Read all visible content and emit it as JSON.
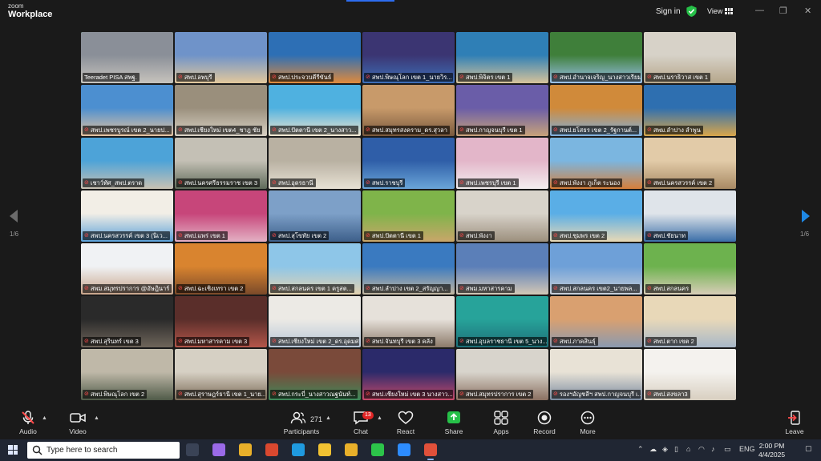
{
  "app": {
    "brand_top": "zoom",
    "brand_name": "Workplace",
    "signin_label": "Sign in",
    "view_label": "View"
  },
  "window_controls": [
    "—",
    "❐",
    "✕"
  ],
  "pagination": {
    "left_count": "1/6",
    "right_count": "1/6"
  },
  "participants": [
    {
      "name": "Teeradet PISA สพฐ.",
      "muted": false,
      "active": true,
      "c1": "#8a8f98",
      "c2": "#c7c3bd"
    },
    {
      "name": "สพป.ลพบุรี",
      "muted": true,
      "c1": "#6f93c9",
      "c2": "#e3c89c"
    },
    {
      "name": "สพป.ประจวบคีรีขันธ์",
      "muted": true,
      "c1": "#2d6fb5",
      "c2": "#e08a3c"
    },
    {
      "name": "สพป.พิษณุโลก เขต 1_นายวิร...",
      "muted": true,
      "c1": "#3b3572",
      "c2": "#3e6fb8"
    },
    {
      "name": "สพป.พิจิตร เขต 1",
      "muted": true,
      "c1": "#2f7fb6",
      "c2": "#d6c39a"
    },
    {
      "name": "สพป.อำนาจเจริญ_นางสาวเรียมระ",
      "muted": true,
      "c1": "#3f7f3a",
      "c2": "#9bc1ea"
    },
    {
      "name": "สพป.นราธิวาส เขต 1",
      "muted": true,
      "c1": "#d7d2c8",
      "c2": "#b5a68a"
    },
    {
      "name": "สพป.เพชรบูรณ์ เขต 2_นายป...",
      "muted": true,
      "c1": "#4c8fd0",
      "c2": "#e6c3a0"
    },
    {
      "name": "สพป.เชียงใหม่ เขต4_ชาฎ ชัย",
      "muted": true,
      "c1": "#9a8f7c",
      "c2": "#d8d1c4"
    },
    {
      "name": "สพป.ปัตตานี เขต 2_นางสาว...",
      "muted": true,
      "c1": "#4fb1e0",
      "c2": "#f1e6d0"
    },
    {
      "name": "สพป.สมุทรสงคราม_ดร.สุวลา",
      "muted": true,
      "c1": "#c89a6a",
      "c2": "#7a5a3e"
    },
    {
      "name": "สพป.กาญจนบุรี เขต 1",
      "muted": true,
      "c1": "#6a5da8",
      "c2": "#c8a27a"
    },
    {
      "name": "สพป.ยโสธร เขต 2_รัฐกานต์...",
      "muted": true,
      "c1": "#d08a3a",
      "c2": "#7fb0de"
    },
    {
      "name": "สพม.ลำปาง ลำพูน",
      "muted": true,
      "c1": "#2e6fb0",
      "c2": "#d9a64a"
    },
    {
      "name": "เชาว์ทัศ_สพป.ตราด",
      "muted": true,
      "c1": "#4da3d8",
      "c2": "#c9c1b3"
    },
    {
      "name": "สพป.นครศรีธรรมราช เขต 3",
      "muted": true,
      "c1": "#c4c0b5",
      "c2": "#5f6b5a"
    },
    {
      "name": "สพป.อุดรธานี",
      "muted": true,
      "c1": "#b9b1a2",
      "c2": "#e7e1d4"
    },
    {
      "name": "สพป.ราชบุรี",
      "muted": true,
      "c1": "#2f5ea8",
      "c2": "#6aa5d8"
    },
    {
      "name": "สพป.เพชรบุรี เขต 1",
      "muted": true,
      "c1": "#e3b6c9",
      "c2": "#f3eef0"
    },
    {
      "name": "สพป.พังงา ภูเก็ต ระนอง",
      "muted": true,
      "c1": "#7bb6e0",
      "c2": "#d77f3a"
    },
    {
      "name": "สพป.นครสวรรค์ เขต 2",
      "muted": true,
      "c1": "#e2cba8",
      "c2": "#a88a64"
    },
    {
      "name": "สพป.นครสวรรค์ เขต 3 (นิเว...",
      "muted": true,
      "c1": "#f2eee6",
      "c2": "#5aa0d8"
    },
    {
      "name": "สพป.แพร่ เขต 1",
      "muted": true,
      "c1": "#c7467a",
      "c2": "#e3b1c4"
    },
    {
      "name": "สพป.สุโขทัย เขต 2",
      "muted": true,
      "c1": "#7da0c8",
      "c2": "#3d5f8a"
    },
    {
      "name": "สพป.ปัตตานี เขต 1",
      "muted": true,
      "c1": "#7fb44a",
      "c2": "#c9a66a"
    },
    {
      "name": "สพป.พังงา",
      "muted": true,
      "c1": "#d8d3ca",
      "c2": "#9c8f7d"
    },
    {
      "name": "สพป.ชุมพร เขต 2",
      "muted": true,
      "c1": "#5aaee6",
      "c2": "#e8d9b6"
    },
    {
      "name": "สพป.ชัยนาท",
      "muted": true,
      "c1": "#dfe4ea",
      "c2": "#3b6ea8"
    },
    {
      "name": "สพม.สมุทรปราการ @อัษฎินาร์",
      "muted": true,
      "c1": "#f0f2f4",
      "c2": "#c8a48a"
    },
    {
      "name": "สพป.ฉะเชิงเทรา เขต 2",
      "muted": true,
      "c1": "#d9842f",
      "c2": "#7a4a2a"
    },
    {
      "name": "สพป.สกลนคร เขต 1 ครูสต...",
      "muted": true,
      "c1": "#8ec6e8",
      "c2": "#e3d2b0"
    },
    {
      "name": "สพป.ลำปาง เขต 2_สรัญญา...",
      "muted": true,
      "c1": "#3a7ac0",
      "c2": "#c2b6a0"
    },
    {
      "name": "สพม.มหาสารคาม",
      "muted": true,
      "c1": "#5b7fb8",
      "c2": "#d3c8b6"
    },
    {
      "name": "สพป.สกลนคร เขต2_นายพล...",
      "muted": true,
      "c1": "#6ea0d8",
      "c2": "#c8cfd8"
    },
    {
      "name": "สพป.สกลนคร",
      "muted": true,
      "c1": "#6db24e",
      "c2": "#d8cdb8"
    },
    {
      "name": "สพป.สุรินทร์ เขต 3",
      "muted": true,
      "c1": "#2a2a2a",
      "c2": "#6f655a"
    },
    {
      "name": "สพป.มหาสารคาม เขต 3",
      "muted": true,
      "c1": "#5a2e2a",
      "c2": "#b4564a"
    },
    {
      "name": "สพป.เชียงใหม่ เขต 2_ดร.อุดมศร",
      "muted": true,
      "c1": "#eceae5",
      "c2": "#b7c7d8"
    },
    {
      "name": "สพป.จันทบุรี เขต 3 คลัง",
      "muted": true,
      "c1": "#e6e1da",
      "c2": "#8c7a6a"
    },
    {
      "name": "สพป.อุบลราชธานี เขต 5_นาง...",
      "muted": true,
      "c1": "#27a39a",
      "c2": "#1d6f78"
    },
    {
      "name": "สพป.ภาคสินธุ์",
      "muted": true,
      "c1": "#d9a070",
      "c2": "#8a9ab0"
    },
    {
      "name": "สพป.ตาก เขต 2",
      "muted": true,
      "c1": "#e8d8b8",
      "c2": "#a8b8c8"
    },
    {
      "name": "สพป.พิษณุโลก เขต 2",
      "muted": true,
      "c1": "#bfb8a8",
      "c2": "#4f5a48"
    },
    {
      "name": "สพป.สุราษฎร์ธานี เขต 1_นาย...",
      "muted": true,
      "c1": "#d6d0c4",
      "c2": "#7a6a56"
    },
    {
      "name": "สพป.กระบี่_นางสาวณฐนันท์...",
      "muted": true,
      "c1": "#7a4a3a",
      "c2": "#3e8a5a"
    },
    {
      "name": "สพป.เชียงใหม่ เขต 3 นางสาว...",
      "muted": true,
      "c1": "#2b2a6a",
      "c2": "#c84a6a"
    },
    {
      "name": "สพป.สมุทรปราการ เขต 2",
      "muted": true,
      "c1": "#d8d4cc",
      "c2": "#8a7060"
    },
    {
      "name": "รองฯอัญชลีฯ สพป.กาญจนบุรี เ...",
      "muted": true,
      "c1": "#e8e2d6",
      "c2": "#7a8aa0"
    },
    {
      "name": "สพป.สงขลา3",
      "muted": true,
      "c1": "#f4f2ee",
      "c2": "#d8cfc0"
    }
  ],
  "controls": [
    {
      "label": "Audio",
      "icon": "mic-muted-icon"
    },
    {
      "label": "Video",
      "icon": "video-icon"
    },
    {
      "label": "Participants",
      "icon": "participants-icon",
      "count": "271"
    },
    {
      "label": "Chat",
      "icon": "chat-icon",
      "badge": "13"
    },
    {
      "label": "React",
      "icon": "heart-icon"
    },
    {
      "label": "Share",
      "icon": "share-icon"
    },
    {
      "label": "Apps",
      "icon": "apps-icon"
    },
    {
      "label": "Record",
      "icon": "record-icon"
    },
    {
      "label": "More",
      "icon": "more-icon"
    },
    {
      "label": "Leave",
      "icon": "leave-icon"
    }
  ],
  "taskbar": {
    "search_placeholder": "Type here to search",
    "tray_lang": "ENG",
    "clock_time": "2:00 PM",
    "clock_date": "4/4/2025",
    "apps": [
      {
        "icon": "task-view-icon",
        "color": "#3a4356"
      },
      {
        "icon": "copilot-icon",
        "color": "#9a6ae8"
      },
      {
        "icon": "chrome-icon",
        "color": "#e9b02a"
      },
      {
        "icon": "app-red-icon",
        "color": "#d9482f"
      },
      {
        "icon": "edge-icon",
        "color": "#1f9ae0"
      },
      {
        "icon": "file-explorer-icon",
        "color": "#f1c232"
      },
      {
        "icon": "chrome-2-icon",
        "color": "#e9b02a"
      },
      {
        "icon": "line-icon",
        "color": "#2cc44a"
      },
      {
        "icon": "zoom-icon",
        "color": "#2d8cff"
      },
      {
        "icon": "app-active-icon",
        "color": "#e0503a"
      }
    ]
  },
  "colors": {
    "active_speaker": "#3bd16f",
    "share_green": "#26c048",
    "muted_red": "#ff4a4a",
    "next_page_blue": "#1e88e5"
  }
}
